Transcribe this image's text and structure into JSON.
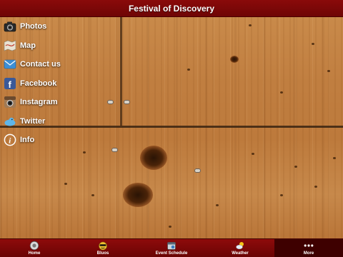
{
  "header": {
    "title": "Festival of Discovery"
  },
  "menu": {
    "items": [
      {
        "label": "Photos",
        "icon": "camera-icon"
      },
      {
        "label": "Map",
        "icon": "map-icon"
      },
      {
        "label": "Contact us",
        "icon": "contact-icon"
      },
      {
        "label": "Facebook",
        "icon": "facebook-icon"
      },
      {
        "label": "Instagram",
        "icon": "instagram-icon"
      },
      {
        "label": "Twitter",
        "icon": "twitter-icon"
      },
      {
        "label": "Info",
        "icon": "info-icon"
      }
    ]
  },
  "tabbar": {
    "items": [
      {
        "label": "Home",
        "icon": "home-icon"
      },
      {
        "label": "Bluos",
        "icon": "bluos-icon"
      },
      {
        "label": "Event Schedule",
        "icon": "calendar-icon"
      },
      {
        "label": "Weather",
        "icon": "weather-icon"
      },
      {
        "label": "More",
        "icon": "more-icon",
        "active": true
      }
    ]
  },
  "colors": {
    "header": "#7c0808",
    "tabbar": "#7c0808",
    "active_tab": "#3e0000",
    "text": "#ffffff"
  }
}
